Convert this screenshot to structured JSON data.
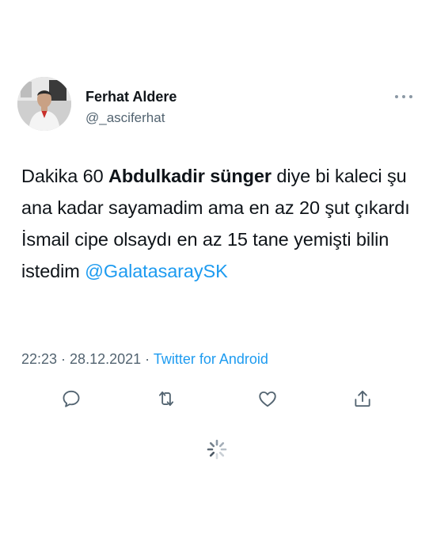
{
  "author": {
    "name": "Ferhat Aldere",
    "handle": "@_asciferhat",
    "avatar_icon": "profile-photo"
  },
  "tweet": {
    "parts": {
      "p1": "Dakika 60 ",
      "p2_bold": "Abdulkadir sünger",
      "p3": " diye bi kaleci şu ana kadar sayamadim ama en az 20 şut çıkardı İsmail cipe olsaydı en az 15 tane yemişti bilin istedim ",
      "mention": "@GalatasaraySK"
    }
  },
  "meta": {
    "time": "22:23",
    "sep1": " · ",
    "date": "28.12.2021",
    "sep2": " · ",
    "source": "Twitter for Android"
  },
  "actions": {
    "reply_icon": "reply-icon",
    "retweet_icon": "retweet-icon",
    "like_icon": "heart-icon",
    "share_icon": "share-icon"
  },
  "colors": {
    "accent": "#1d9bf0",
    "text": "#0f1419",
    "secondary": "#536471"
  }
}
